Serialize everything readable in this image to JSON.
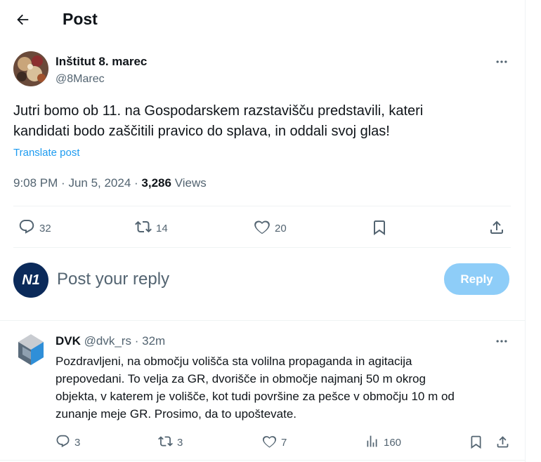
{
  "header": {
    "title": "Post"
  },
  "post": {
    "author_name": "Inštitut 8. marec",
    "author_handle": "@8Marec",
    "text_line1": "Jutri bomo ob 11. na Gospodarskem razstavišču predstavili, kateri",
    "text_line2": "kandidati bodo zaščitili pravico do splava, in oddali svoj glas!",
    "translate_label": "Translate post",
    "time": "9:08 PM",
    "date": "Jun 5, 2024",
    "views_count": "3,286",
    "views_label": "Views",
    "replies": "32",
    "reposts": "14",
    "likes": "20"
  },
  "composer": {
    "placeholder": "Post your reply",
    "reply_button": "Reply",
    "avatar_text": "N1"
  },
  "reply": {
    "author_name": "DVK",
    "author_handle": "@dvk_rs",
    "time_ago": "32m",
    "text_line1": "Pozdravljeni, na območju volišča sta volilna propaganda in agitacija",
    "text_line2": "prepovedani. To velja za GR, dvorišče in območje najmanj 50 m okrog",
    "text_line3": "objekta, v katerem je volišče, kot tudi površine za pešce v območju 10 m od",
    "text_line4": "zunanje meje GR. Prosimo, da to upoštevate.",
    "replies": "3",
    "reposts": "3",
    "likes": "7",
    "views": "160"
  },
  "colors": {
    "accent": "#1d9bf0",
    "reply_button_disabled": "#8ecdf8",
    "muted": "#536471"
  }
}
